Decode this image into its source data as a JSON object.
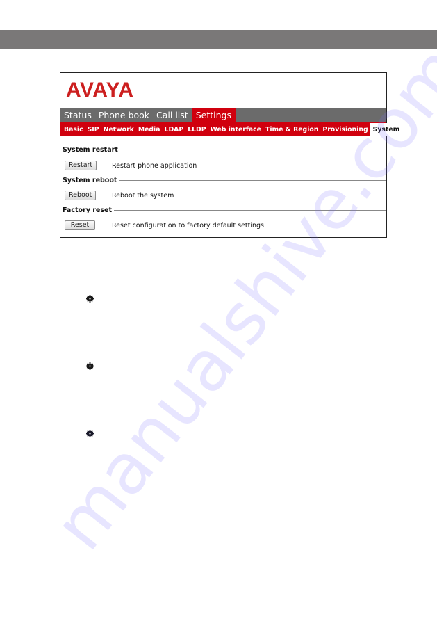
{
  "header_band": {},
  "screenshot": {
    "logo": "AVAYA",
    "main_tabs": [
      {
        "label": "Status",
        "active": false
      },
      {
        "label": "Phone book",
        "active": false
      },
      {
        "label": "Call list",
        "active": false
      },
      {
        "label": "Settings",
        "active": true
      }
    ],
    "sub_tabs": [
      {
        "label": "Basic",
        "active": false
      },
      {
        "label": "SIP",
        "active": false
      },
      {
        "label": "Network",
        "active": false
      },
      {
        "label": "Media",
        "active": false
      },
      {
        "label": "LDAP",
        "active": false
      },
      {
        "label": "LLDP",
        "active": false
      },
      {
        "label": "Web interface",
        "active": false
      },
      {
        "label": "Time & Region",
        "active": false
      },
      {
        "label": "Provisioning",
        "active": false
      },
      {
        "label": "System",
        "active": true
      }
    ],
    "sections": [
      {
        "title": "System restart",
        "button": "Restart",
        "description": "Restart phone application"
      },
      {
        "title": "System reboot",
        "button": "Reboot",
        "description": "Reboot the system"
      },
      {
        "title": "Factory reset",
        "button": "Reset",
        "description": "Reset configuration to factory default settings"
      }
    ]
  },
  "bullets": [
    "gear-bullet",
    "gear-bullet",
    "gear-bullet"
  ],
  "watermark": "manualshive.com",
  "colors": {
    "brand_red": "#d0000e",
    "tab_gray": "#6b6b6b",
    "band_gray": "#7a7878"
  }
}
